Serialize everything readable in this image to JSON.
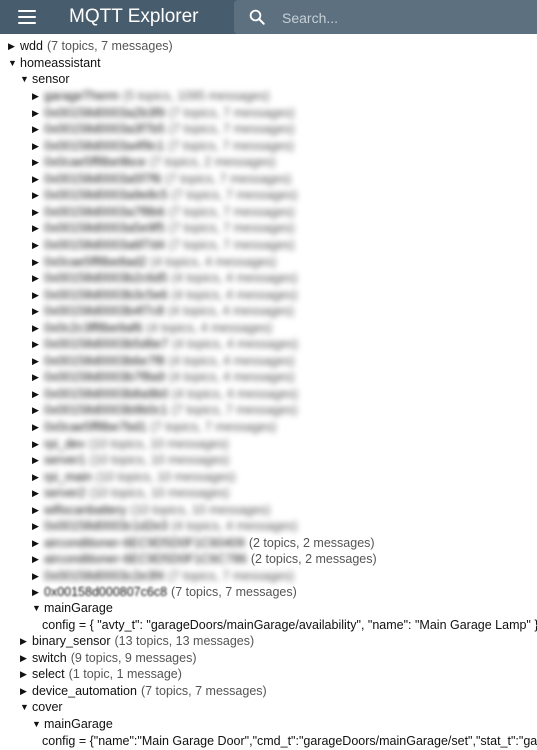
{
  "app": {
    "title": "MQTT Explorer"
  },
  "search": {
    "placeholder": "Search..."
  },
  "tree": {
    "wdd": {
      "name": "wdd",
      "meta": "(7 topics, 7 messages)"
    },
    "homeassistant": {
      "name": "homeassistant"
    },
    "sensor": {
      "name": "sensor"
    },
    "blurred_sensors": [
      {
        "name": "garageTherm",
        "meta": "(5 topics, 1095 messages)"
      },
      {
        "name": "0x00158d0003a2b3f9",
        "meta": "(7 topics, 7 messages)"
      },
      {
        "name": "0x00158d0003a3f7b5",
        "meta": "(7 topics, 7 messages)"
      },
      {
        "name": "0x00158d0003a4f9c1",
        "meta": "(7 topics, 7 messages)"
      },
      {
        "name": "0x0cae5ff8be9bce",
        "meta": "(7 topics, 2 messages)"
      },
      {
        "name": "0x00158d0003a5f7f6",
        "meta": "(7 topics, 7 messages)"
      },
      {
        "name": "0x00158d0003a9e8c5",
        "meta": "(7 topics, 7 messages)"
      },
      {
        "name": "0x00158d0003a7f8b6",
        "meta": "(7 topics, 7 messages)"
      },
      {
        "name": "0x00158d0003a5e9f5",
        "meta": "(7 topics, 7 messages)"
      },
      {
        "name": "0x00158d0003a6f7d4",
        "meta": "(7 topics, 7 messages)"
      },
      {
        "name": "0x0cae5ff8be8ad2",
        "meta": "(4 topics, 4 messages)"
      },
      {
        "name": "0x00158d0003b2c6d5",
        "meta": "(4 topics, 4 messages)"
      },
      {
        "name": "0x00158d0003b3c5e6",
        "meta": "(4 topics, 4 messages)"
      },
      {
        "name": "0x00158d0003b4f7c8",
        "meta": "(4 topics, 4 messages)"
      },
      {
        "name": "0x0c2c3ff8be9af6",
        "meta": "(4 topics, 4 messages)"
      },
      {
        "name": "0x00158d0003b5d6e7",
        "meta": "(4 topics, 4 messages)"
      },
      {
        "name": "0x00158d0003b6e7f8",
        "meta": "(4 topics, 4 messages)"
      },
      {
        "name": "0x00158d0003b7f8a9",
        "meta": "(4 topics, 4 messages)"
      },
      {
        "name": "0x00158d0003b8a9b0",
        "meta": "(4 topics, 4 messages)"
      },
      {
        "name": "0x00158d0003b9b0c1",
        "meta": "(7 topics, 7 messages)"
      },
      {
        "name": "0x0cae5ff8be7bd1",
        "meta": "(7 topics, 7 messages)"
      },
      {
        "name": "rpi_dev",
        "meta": "(10 topics, 10 messages)"
      },
      {
        "name": "server1",
        "meta": "(10 topics, 10 messages)"
      },
      {
        "name": "rpi_main",
        "meta": "(10 topics, 10 messages)"
      },
      {
        "name": "server2",
        "meta": "(10 topics, 10 messages)"
      },
      {
        "name": "wifiscanbattery",
        "meta": "(10 topics, 10 messages)"
      },
      {
        "name": "0x00158d0003c1d2e3",
        "meta": "(4 topics, 4 messages)"
      },
      {
        "name": "airconditioner-6EC9D5D0F1C60409",
        "meta": "(2 topics, 2 messages)"
      },
      {
        "name": "airconditioner-6EC9D5D0F1C6C786",
        "meta": "(2 topics, 2 messages)"
      },
      {
        "name": "0x00158d0003c2e3f4",
        "meta": "(7 topics, 7 messages)"
      }
    ],
    "last_sensor": {
      "name": "0x00158d000807c6c8",
      "meta": "(7 topics, 7 messages)"
    },
    "mainGarage_sensor": {
      "name": "mainGarage"
    },
    "mainGarage_config": {
      "text": "config = { \"avty_t\": \"garageDoors/mainGarage/availability\", \"name\": \"Main Garage Lamp\" }"
    },
    "binary_sensor": {
      "name": "binary_sensor",
      "meta": "(13 topics, 13 messages)"
    },
    "switch": {
      "name": "switch",
      "meta": "(9 topics, 9 messages)"
    },
    "select": {
      "name": "select",
      "meta": "(1 topic, 1 message)"
    },
    "device_automation": {
      "name": "device_automation",
      "meta": "(7 topics, 7 messages)"
    },
    "cover": {
      "name": "cover"
    },
    "mainGarage_cover": {
      "name": "mainGarage"
    },
    "cover_config": {
      "text": "config = {\"name\":\"Main Garage Door\",\"cmd_t\":\"garageDoors/mainGarage/set\",\"stat_t\":\"garageDoors/mainGarage/state\"}"
    }
  },
  "icons": {
    "expanded": "triangle-down",
    "collapsed": "triangle-right"
  },
  "colors": {
    "header": "#475c6c",
    "search": "#5c7080"
  }
}
